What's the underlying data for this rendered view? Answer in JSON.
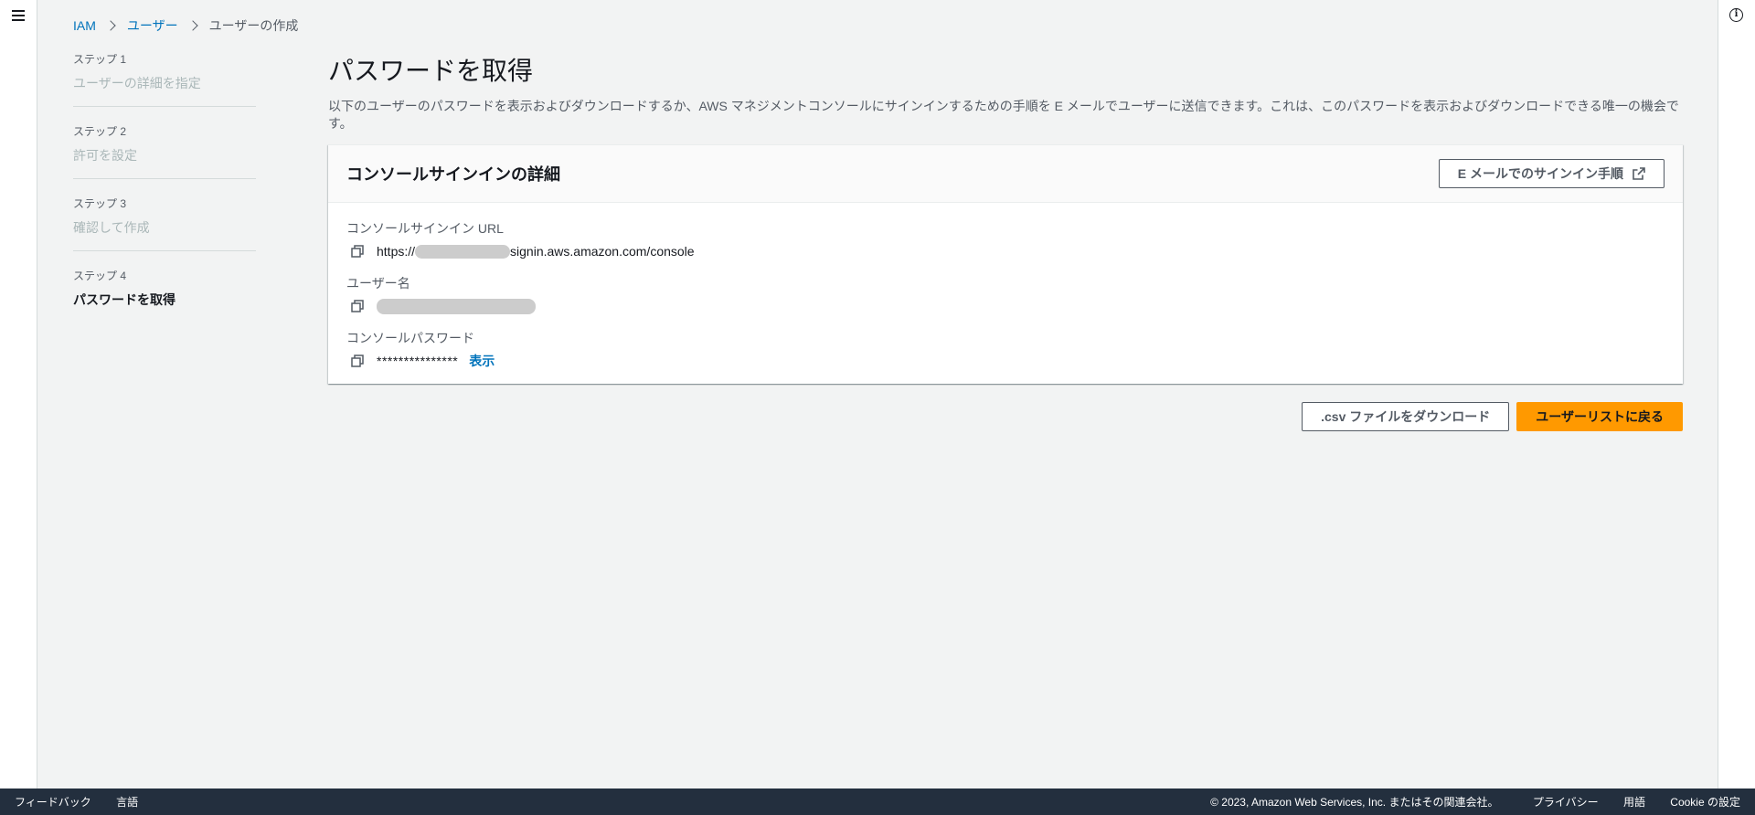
{
  "colors": {
    "link": "#0073bb",
    "primary": "#ff9900",
    "footer_bg": "#232f3e",
    "page_bg": "#f2f3f3"
  },
  "breadcrumb": {
    "root": "IAM",
    "parent": "ユーザー",
    "current": "ユーザーの作成"
  },
  "steps": [
    {
      "label": "ステップ 1",
      "title": "ユーザーの詳細を指定"
    },
    {
      "label": "ステップ 2",
      "title": "許可を設定"
    },
    {
      "label": "ステップ 3",
      "title": "確認して作成"
    },
    {
      "label": "ステップ 4",
      "title": "パスワードを取得"
    }
  ],
  "main": {
    "title": "パスワードを取得",
    "description": "以下のユーザーのパスワードを表示およびダウンロードするか、AWS マネジメントコンソールにサインインするための手順を E メールでユーザーに送信できます。これは、このパスワードを表示およびダウンロードできる唯一の機会です。"
  },
  "panel": {
    "title": "コンソールサインインの詳細",
    "email_button": "E メールでのサインイン手順",
    "url_label": "コンソールサインイン URL",
    "url_prefix": "https://",
    "url_suffix": "signin.aws.amazon.com/console",
    "username_label": "ユーザー名",
    "password_label": "コンソールパスワード",
    "password_mask": "***************",
    "show_link": "表示"
  },
  "actions": {
    "download_csv": ".csv ファイルをダウンロード",
    "back_to_users": "ユーザーリストに戻る"
  },
  "footer": {
    "feedback": "フィードバック",
    "language": "言語",
    "copyright": "© 2023, Amazon Web Services, Inc. またはその関連会社。",
    "privacy": "プライバシー",
    "terms": "用語",
    "cookies": "Cookie の設定"
  },
  "icons": {
    "menu": "hamburger-menu-icon",
    "info": "info-icon",
    "copy": "copy-icon",
    "external": "external-link-icon",
    "chevron": "chevron-right-icon"
  }
}
